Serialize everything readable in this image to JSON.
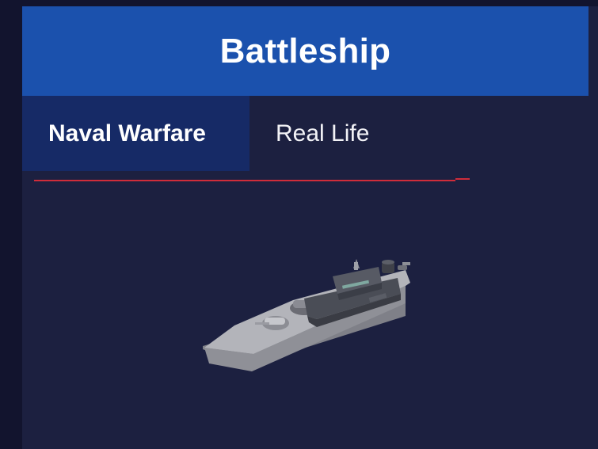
{
  "header": {
    "title": "Battleship"
  },
  "tabs": [
    {
      "label": "Naval Warfare",
      "active": true
    },
    {
      "label": "Real Life",
      "active": false
    }
  ],
  "colors": {
    "title_bar": "#1b51ad",
    "panel_bg": "#1c2040",
    "active_tab_bg": "#162a66",
    "underline": "#cf2c3a"
  },
  "image": {
    "icon": "battleship-model-icon"
  }
}
